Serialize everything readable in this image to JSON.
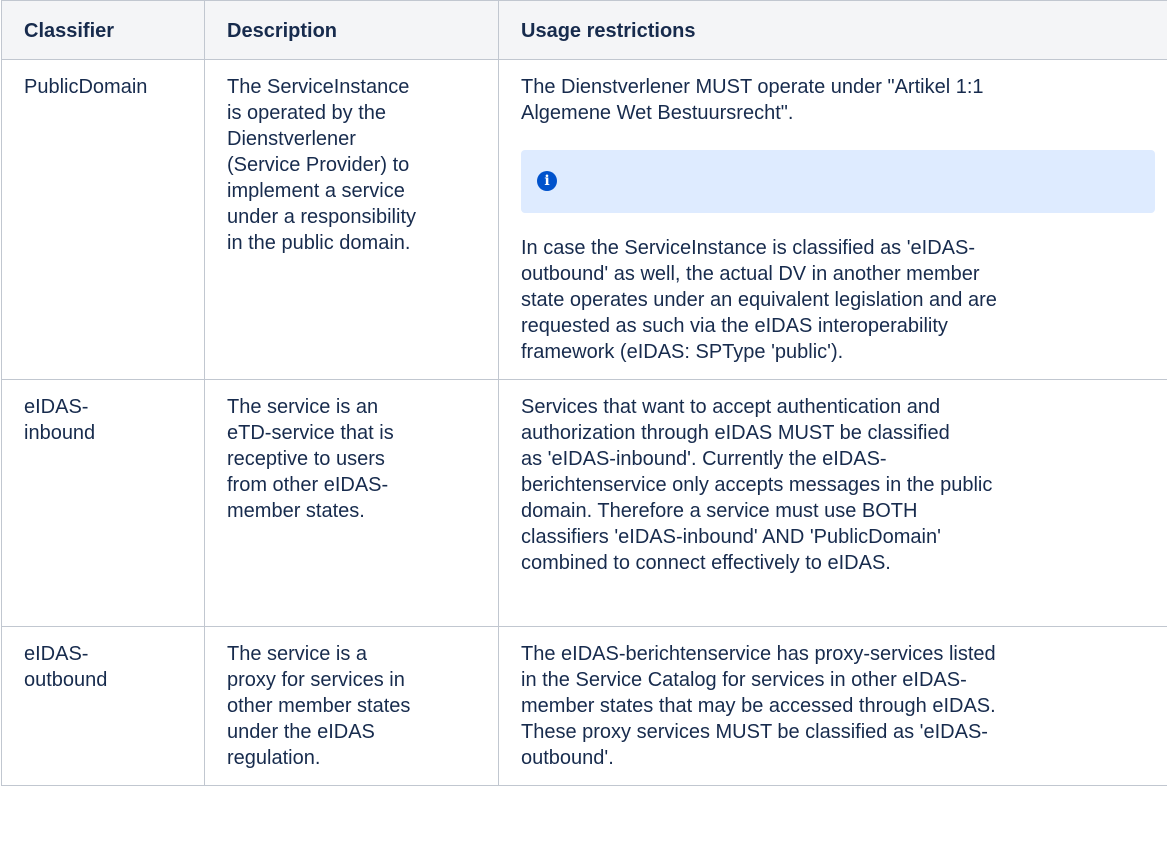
{
  "table": {
    "headers": [
      "Classifier",
      "Description",
      "Usage restrictions"
    ],
    "rows": [
      {
        "classifier": "PublicDomain",
        "description": "The ServiceInstance\nis operated by the\nDienstverlener\n(Service Provider) to\nimplement a service\nunder a responsibility\nin the public domain.",
        "usage_intro": "The Dienstverlener MUST operate under \"Artikel 1:1\nAlgemene Wet Bestuursrecht\".",
        "info_icon": "info-icon",
        "usage_note": "In case the ServiceInstance is classified as 'eIDAS-\noutbound' as well, the actual DV in another member\nstate operates under an equivalent legislation and are\nrequested as such via the eIDAS interoperability\nframework (eIDAS: SPType 'public')."
      },
      {
        "classifier": "eIDAS-\ninbound",
        "description": "The service is an\neTD-service that is\nreceptive to users\nfrom other eIDAS-\nmember states.",
        "usage": "Services that want to accept authentication and\nauthorization through eIDAS MUST be classified\nas 'eIDAS-inbound'. Currently the eIDAS-\nberichtenservice only accepts messages in the public\ndomain. Therefore a service must use BOTH\nclassifiers 'eIDAS-inbound' AND 'PublicDomain'\ncombined to connect effectively to eIDAS."
      },
      {
        "classifier": "eIDAS-\noutbound",
        "description": "The service is a\nproxy for services in\nother member states\nunder the eIDAS\nregulation.",
        "usage": "The eIDAS-berichtenservice has proxy-services listed\nin the Service Catalog for services in other eIDAS-\nmember states that may be accessed through eIDAS.\nThese proxy services MUST be classified as 'eIDAS-\noutbound'."
      }
    ]
  },
  "colors": {
    "header_bg": "#f4f5f7",
    "border": "#c1c7d0",
    "text": "#172b4d",
    "info_panel_bg": "#deebff",
    "info_icon": "#0052cc"
  }
}
